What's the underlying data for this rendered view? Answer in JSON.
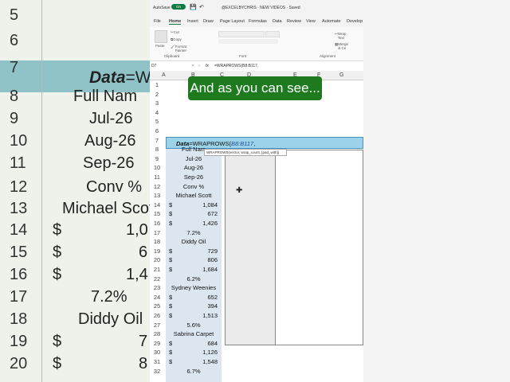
{
  "caption": "And as you can see...",
  "background": {
    "rows": [
      "5",
      "6",
      "7",
      "8",
      "9",
      "10",
      "11",
      "12",
      "13",
      "14",
      "15",
      "16",
      "17",
      "18",
      "19",
      "20"
    ],
    "header_label": "Data",
    "header_formula": "=W",
    "cells": [
      "Full Nam",
      "Jul-26",
      "Aug-26",
      "Sep-26",
      "Conv %",
      "Michael Scot",
      "$",
      "1,0",
      "$",
      "6",
      "$",
      "1,4",
      "7.2%",
      "Diddy Oil",
      "$",
      "7",
      "$",
      "8"
    ]
  },
  "excel": {
    "autosave_label": "AutoSave",
    "autosave_state": "On",
    "doc_title": "@EXCELBYCHRIS · NEW VIDEOS · Saved",
    "menu": [
      "File",
      "Home",
      "Insert",
      "Draw",
      "Page Layout",
      "Formulas",
      "Data",
      "Review",
      "View",
      "Automate",
      "Develop"
    ],
    "ribbon": {
      "cut": "Cut",
      "copy": "Copy",
      "format_painter": "Format Painter",
      "paste": "Paste",
      "clipboard": "Clipboard",
      "font": "Font",
      "wrap_text": "Wrap Text",
      "merge": "Merge & Ce",
      "alignment": "Alignment"
    },
    "name_box": "D7",
    "formula": "=WRAPROWS(B8:B117,",
    "columns": [
      "A",
      "B",
      "C",
      "D",
      "E",
      "F",
      "G"
    ],
    "tooltip": "WRAPROWS(vector, wrap_count, [pad_with])",
    "cell_b7_label": "Data",
    "cell_b7_formula": "=WRAPROWS(",
    "cell_b7_ref": "B8:B117",
    "cell_b7_comma": ",",
    "rows": [
      {
        "n": "1",
        "c": "",
        "v": ""
      },
      {
        "n": "2",
        "c": "",
        "v": ""
      },
      {
        "n": "3",
        "c": "",
        "v": ""
      },
      {
        "n": "4",
        "c": "",
        "v": ""
      },
      {
        "n": "5",
        "c": "",
        "v": ""
      },
      {
        "n": "6",
        "c": "",
        "v": ""
      },
      {
        "n": "7",
        "c": "",
        "v": ""
      },
      {
        "n": "8",
        "c": "Full Nam",
        "v": ""
      },
      {
        "n": "9",
        "c": "Jul-26",
        "v": ""
      },
      {
        "n": "10",
        "c": "Aug-26",
        "v": ""
      },
      {
        "n": "11",
        "c": "Sep-26",
        "v": ""
      },
      {
        "n": "12",
        "c": "Conv %",
        "v": ""
      },
      {
        "n": "13",
        "c": "Michael Scott",
        "v": ""
      },
      {
        "n": "14",
        "c": "$",
        "v": "1,084"
      },
      {
        "n": "15",
        "c": "$",
        "v": "672"
      },
      {
        "n": "16",
        "c": "$",
        "v": "1,426"
      },
      {
        "n": "17",
        "c": "7.2%",
        "v": ""
      },
      {
        "n": "18",
        "c": "Diddy Oil",
        "v": ""
      },
      {
        "n": "19",
        "c": "$",
        "v": "729"
      },
      {
        "n": "20",
        "c": "$",
        "v": "806"
      },
      {
        "n": "21",
        "c": "$",
        "v": "1,684"
      },
      {
        "n": "22",
        "c": "6.2%",
        "v": ""
      },
      {
        "n": "23",
        "c": "Sydney Weenies",
        "v": ""
      },
      {
        "n": "24",
        "c": "$",
        "v": "652"
      },
      {
        "n": "25",
        "c": "$",
        "v": "394"
      },
      {
        "n": "26",
        "c": "$",
        "v": "1,513"
      },
      {
        "n": "27",
        "c": "5.6%",
        "v": ""
      },
      {
        "n": "28",
        "c": "Sabrina Carpet",
        "v": ""
      },
      {
        "n": "29",
        "c": "$",
        "v": "684"
      },
      {
        "n": "30",
        "c": "$",
        "v": "1,126"
      },
      {
        "n": "31",
        "c": "$",
        "v": "1,548"
      },
      {
        "n": "32",
        "c": "6.7%",
        "v": ""
      }
    ]
  }
}
